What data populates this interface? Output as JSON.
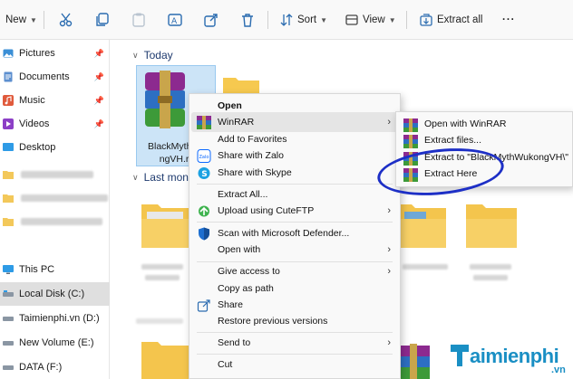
{
  "toolbar": {
    "new_label": "New",
    "sort_label": "Sort",
    "view_label": "View",
    "extract_all_label": "Extract all",
    "more_label": "···"
  },
  "nav": {
    "items": [
      {
        "label": "Pictures",
        "icon": "pictures-icon",
        "pinned": true
      },
      {
        "label": "Documents",
        "icon": "documents-icon",
        "pinned": true
      },
      {
        "label": "Music",
        "icon": "music-icon",
        "pinned": true
      },
      {
        "label": "Videos",
        "icon": "videos-icon",
        "pinned": true
      },
      {
        "label": "Desktop",
        "icon": "desktop-icon",
        "pinned": false
      }
    ],
    "this_pc": "This PC",
    "drives": [
      {
        "label": "Local Disk (C:)",
        "selected": true
      },
      {
        "label": "Taimienphi.vn (D:)",
        "selected": false
      },
      {
        "label": "New Volume (E:)",
        "selected": false
      },
      {
        "label": "DATA (F:)",
        "selected": false
      }
    ]
  },
  "content": {
    "group_today": "Today",
    "group_last_month": "Last mont",
    "selected_file_line1": "BlackMythWu",
    "selected_file_line2": "ngVH.ra"
  },
  "context_menu": {
    "items": [
      {
        "label": "Open",
        "bold": true
      },
      {
        "label": "WinRAR",
        "submenu": true
      },
      {
        "label": "Add to Favorites"
      },
      {
        "label": "Share with Zalo"
      },
      {
        "label": "Share with Skype"
      },
      {
        "label": "Extract All..."
      },
      {
        "label": "Upload using CuteFTP",
        "submenu": true
      },
      {
        "label": "Scan with Microsoft Defender..."
      },
      {
        "label": "Open with",
        "submenu": true
      },
      {
        "label": "Give access to",
        "submenu": true
      },
      {
        "label": "Copy as path"
      },
      {
        "label": "Share"
      },
      {
        "label": "Restore previous versions"
      },
      {
        "label": "Send to",
        "submenu": true
      },
      {
        "label": "Cut"
      }
    ],
    "arrow": "›"
  },
  "winrar_submenu": {
    "items": [
      {
        "label": "Open with WinRAR"
      },
      {
        "label": "Extract files..."
      },
      {
        "label": "Extract to \"BlackMythWukongVH\\\""
      },
      {
        "label": "Extract Here"
      }
    ]
  },
  "watermark": {
    "brand": "aimienphi",
    "suffix": ".vn"
  },
  "colors": {
    "accent_blue": "#1d2fc6",
    "selection": "#cce4f7",
    "folder_yellow": "#f6c94f",
    "watermark": "#1a8fc4"
  }
}
